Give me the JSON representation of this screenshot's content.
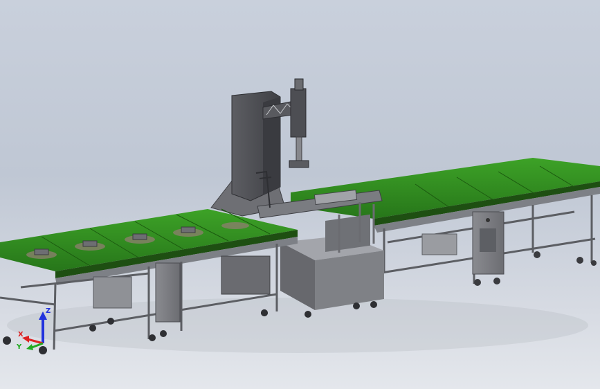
{
  "viewport": {
    "background_top": "#c9d0dc",
    "background_bottom": "#e4e7ec"
  },
  "colors": {
    "belt": "#2f8a1d",
    "belt_edge": "#1e5c12",
    "frame": "#8e9096",
    "frame_dark": "#5a5c61",
    "machine": "#4a4b50"
  },
  "model": {
    "name_icon": "assembly-conveyor-robot-model"
  },
  "triad": {
    "z_label": "Z",
    "x_label": "X",
    "y_label": "Y",
    "z_color": "#2233dd",
    "x_color": "#dd2222",
    "y_color": "#22aa22"
  }
}
